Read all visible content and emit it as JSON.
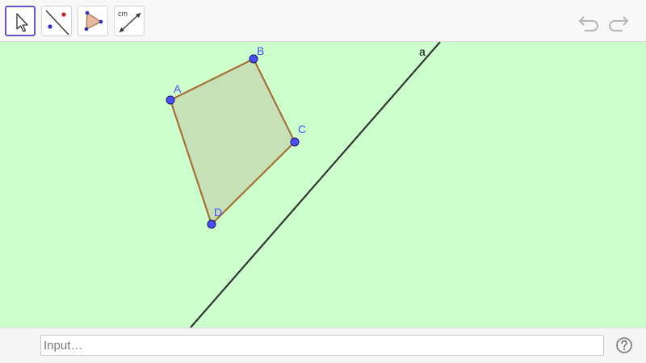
{
  "toolbar": {
    "tools": [
      {
        "icon": "move-arrow-icon",
        "selected": true
      },
      {
        "icon": "line-through-two-points-icon",
        "selected": false
      },
      {
        "icon": "polygon-icon",
        "selected": false
      },
      {
        "icon": "distance-length-icon",
        "label": "cm",
        "selected": false
      }
    ],
    "undo_icon": "undo-icon",
    "redo_icon": "redo-icon"
  },
  "graphics": {
    "background_color": "#ccffcc",
    "polygon": {
      "fill_color": "#c5e1b5",
      "edge_color": "#a86f3a",
      "vertices": [
        {
          "name": "A"
        },
        {
          "name": "B"
        },
        {
          "name": "C"
        },
        {
          "name": "D"
        }
      ]
    },
    "point_color": "#4d4dff",
    "line": {
      "name": "a",
      "color": "#333333"
    }
  },
  "input_bar": {
    "placeholder": "Input…",
    "help_icon": "help-icon"
  }
}
